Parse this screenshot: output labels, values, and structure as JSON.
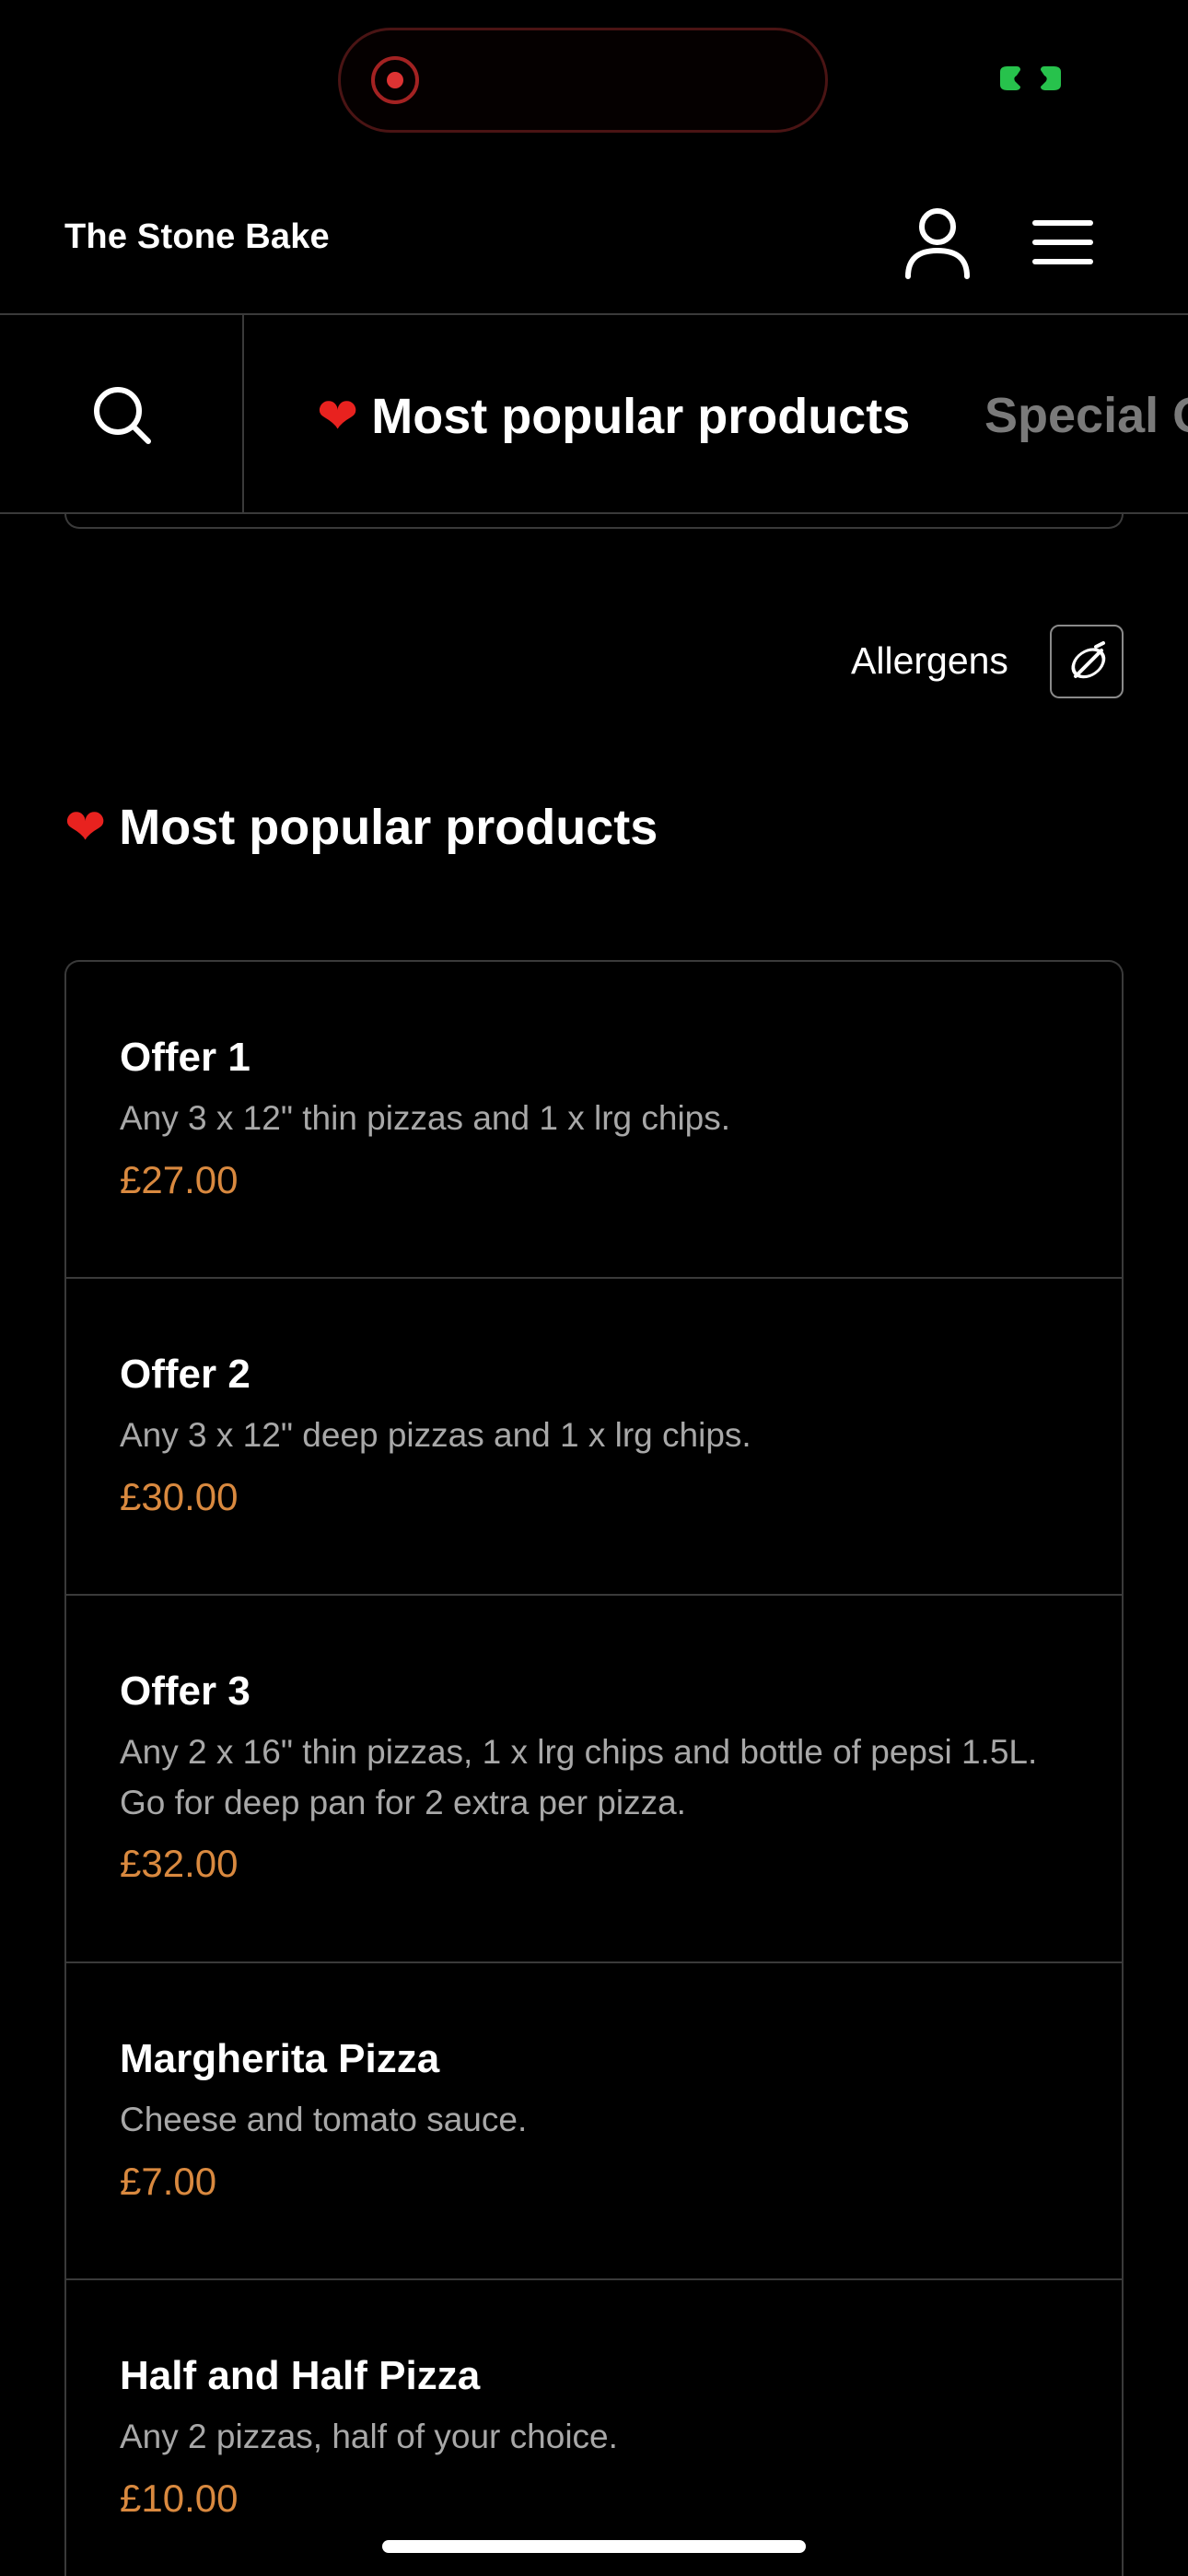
{
  "header": {
    "brand": "The Stone Bake"
  },
  "category_nav": {
    "tabs": [
      {
        "icon": "heart-emoji",
        "label": "Most popular products",
        "active": true
      },
      {
        "label": "Special O",
        "active": false
      }
    ]
  },
  "allergens": {
    "label": "Allergens",
    "icon": "allergens-icon"
  },
  "section": {
    "icon": "heart-emoji",
    "title": "Most popular products"
  },
  "products": [
    {
      "name": "Offer 1",
      "description": "Any 3 x 12\" thin pizzas and 1 x lrg chips.",
      "price": "£27.00"
    },
    {
      "name": "Offer 2",
      "description": "Any 3 x 12\" deep pizzas and 1 x lrg chips.",
      "price": "£30.00"
    },
    {
      "name": "Offer 3",
      "description": "Any 2 x 16\" thin pizzas, 1 x lrg chips and bottle of pepsi 1.5L. Go for deep pan for 2 extra per pizza.",
      "price": "£32.00"
    },
    {
      "name": "Margherita Pizza",
      "description": "Cheese and tomato sauce.",
      "price": "£7.00"
    },
    {
      "name": "Half and Half Pizza",
      "description": "Any 2 pizzas, half of your choice.",
      "price": "£10.00"
    }
  ],
  "colors": {
    "background": "#000000",
    "price": "#d9893f",
    "heart": "#e8221f",
    "divider": "#3a3a3a",
    "inactive_tab": "#7a7a7a"
  }
}
